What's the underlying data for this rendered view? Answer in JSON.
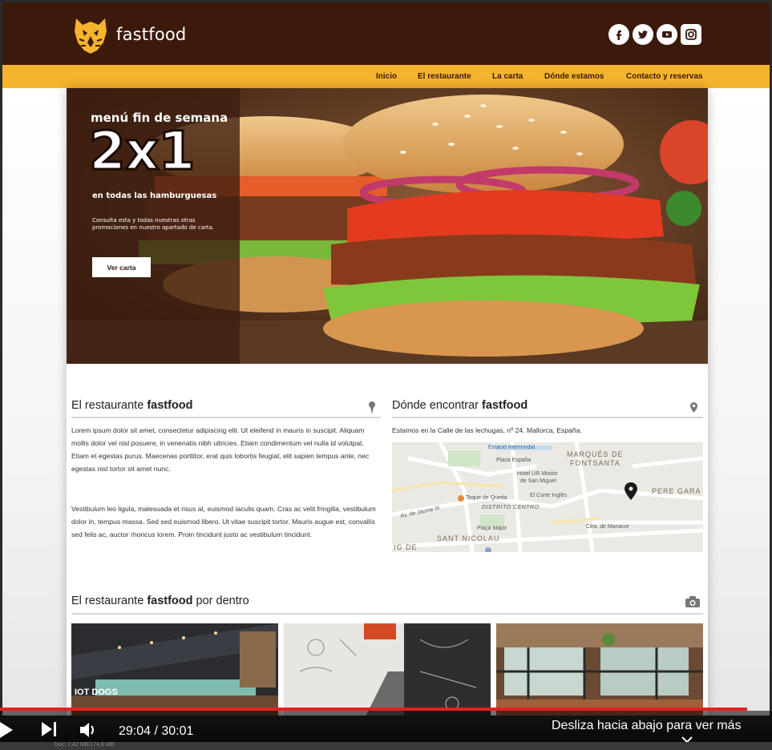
{
  "header": {
    "brand": "fastfood",
    "social": [
      "facebook-icon",
      "twitter-icon",
      "youtube-icon",
      "instagram-icon"
    ],
    "youtube_text": "You\nTube"
  },
  "nav": {
    "items": [
      "Inicio",
      "El restaurante",
      "La carta",
      "Dónde estamos",
      "Contacto y reservas"
    ]
  },
  "hero": {
    "small_title": "menú fin de semana",
    "big_title": "2x1",
    "subtitle": "en todas las hamburguesas",
    "description": "Consulta esta y todas nuestras otras promociones en nuestro apartado de carta.",
    "button_label": "Ver carta"
  },
  "restaurant": {
    "title_prefix": "El restaurante ",
    "title_bold": "fastfood",
    "paragraph1": "Lorem ipsum dolor sit amet, consectetur adipiscing elit. Ut eleifend in mauris in suscipit. Aliquam mollis dolor vel nisl posuere, in venenatis nibh ultricies. Etiam condimentum vel nulla id volutpat. Etiam et egestas purus. Maecenas porttitor, erat quis lobortis feugiat, elit sapien tempus ante, nec egestas nisl tortor sit amet nunc.",
    "paragraph2": "Vestibulum leo ligula, malesuada et risus at, euismod iaculis quam. Cras ac velit fringilla, vestibulum dolor in, tempus massa. Sed sed euismod libero. Ut vitae suscipit tortor. Mauris augue est, convallis sed felis ac, auctor rhoncus lorem. Proin tincidunt justo ac vestibulum tincidunt."
  },
  "location": {
    "title_prefix": "Dónde encontrar ",
    "title_bold": "fastfood",
    "address": "Estamos en la Calle de las lechugas, nº 24. Mallorca, España.",
    "map_labels": {
      "estacio": "Estació Intermodal",
      "plaza_espana": "Plaza España",
      "marques": "MARQUÉS DE",
      "fontsanta": "FONTSANTA",
      "hotel1": "Hotel UR Misión",
      "hotel2": "de San Miguel",
      "pere_gara": "PERE GARA",
      "toque": "Toque de Queda",
      "distrito": "DISTRITO CENTRO",
      "corte": "El Corte Inglés",
      "plaza_major": "Plaça Major",
      "sant_nicolau": "SANT NICOLAU",
      "manacor": "Ctra. de Manacor",
      "jaume": "Av. de Jaume III",
      "ig_de": "IG DE"
    }
  },
  "inside": {
    "title_prefix": "El restaurante ",
    "title_bold": "fastfood",
    "title_suffix": " por dentro",
    "photo1_sign": "IOT DOGS"
  },
  "player": {
    "time": "29:04 / 30:01",
    "hint": "Desliza hacia abajo para ver más",
    "progress": 0.968,
    "status": "Doc: 7,42 MB/174,8 MB"
  },
  "colors": {
    "header_bg": "#3b1a0c",
    "nav_bg": "#f5b42e",
    "accent": "#f5b42e",
    "progress": "#e52020"
  }
}
